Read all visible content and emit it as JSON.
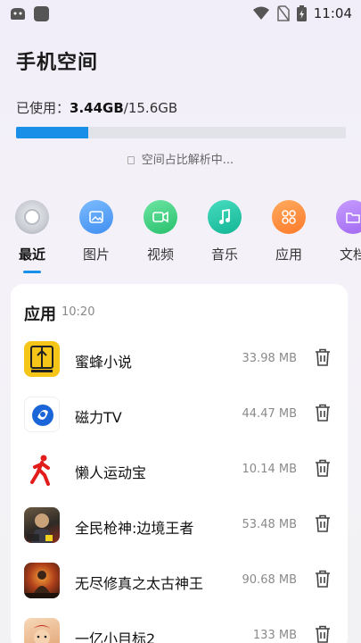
{
  "status": {
    "time": "11:04"
  },
  "page": {
    "title": "手机空间"
  },
  "storage": {
    "used_label": "已使用：",
    "used": "3.44GB",
    "total": "/15.6GB",
    "used_fraction": 0.22,
    "analyzing_text": "空间占比解析中..."
  },
  "categories": [
    {
      "label": "最近",
      "active": true,
      "icon": "recent-icon",
      "color": "#9aa0a8"
    },
    {
      "label": "图片",
      "active": false,
      "icon": "image-icon",
      "color": "#5aa3f2"
    },
    {
      "label": "视频",
      "active": false,
      "icon": "video-icon",
      "color": "#3fcf82"
    },
    {
      "label": "音乐",
      "active": false,
      "icon": "music-icon",
      "color": "#22c4a8"
    },
    {
      "label": "应用",
      "active": false,
      "icon": "apps-icon",
      "color": "#ff8a3d"
    },
    {
      "label": "文档",
      "active": false,
      "icon": "folder-icon",
      "color": "#b07ef5"
    }
  ],
  "card": {
    "header": "应用",
    "time": "10:20",
    "apps": [
      {
        "name": "蜜蜂小说",
        "size": "33.98 MB",
        "icon": "bee-novel-icon"
      },
      {
        "name": "磁力TV",
        "size": "44.47 MB",
        "icon": "magnet-tv-icon"
      },
      {
        "name": "懒人运动宝",
        "size": "10.14 MB",
        "icon": "runner-icon"
      },
      {
        "name": "全民枪神:边境王者",
        "size": "53.48 MB",
        "icon": "game-warrior-icon"
      },
      {
        "name": "无尽修真之太古神王",
        "size": "90.68 MB",
        "icon": "game-cultivation-icon"
      },
      {
        "name": "一亿小目标2",
        "size": "133 MB",
        "icon": "game-target-icon"
      }
    ]
  }
}
